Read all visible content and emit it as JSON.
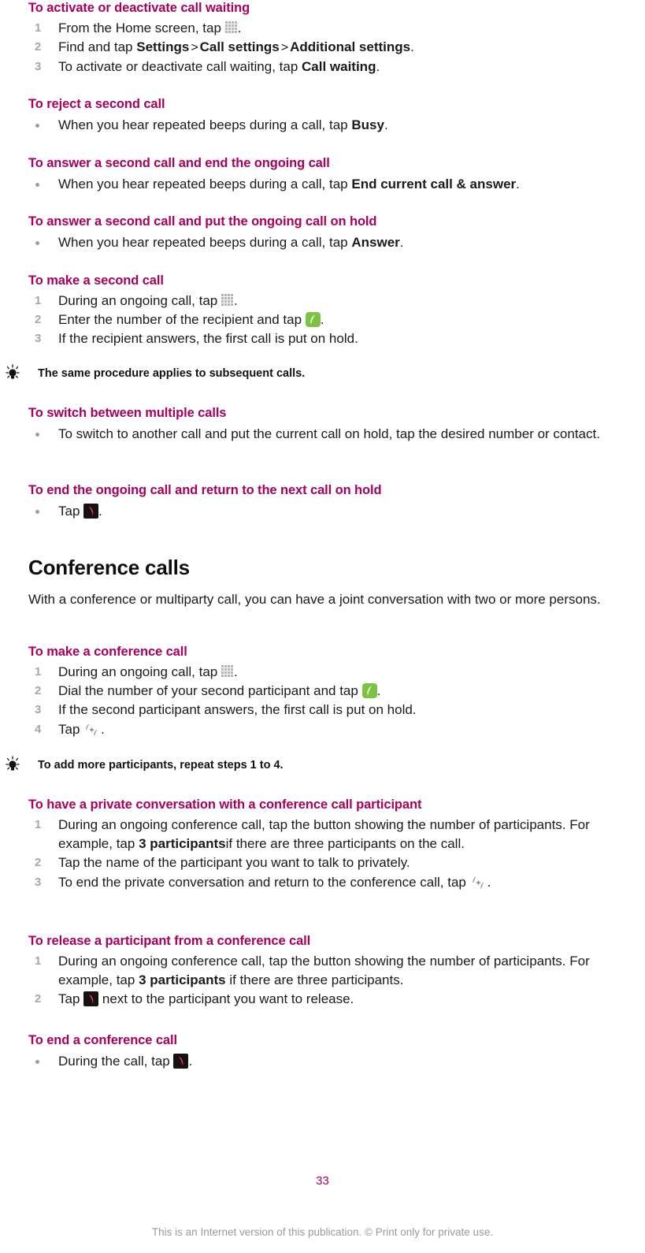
{
  "document": {
    "page_number": "33",
    "footer_note": "This is an Internet version of this publication. © Print only for private use.",
    "accent_color": "#a8005c",
    "body_color": "#1a1a1a",
    "number_color": "#a6a6a6",
    "call_icon_color": "#7dc242",
    "end_call_icon_color": "#17110f"
  },
  "sections": {
    "call_waiting": {
      "title": "To activate or deactivate call waiting",
      "steps": [
        {
          "num": "1",
          "pre": "From the Home screen, tap ",
          "icon": "app-drawer-grid-icon",
          "post": "."
        },
        {
          "num": "2",
          "pre": "Find and tap ",
          "b1": "Settings",
          "sep1": ">",
          "b2": "Call settings",
          "sep2": ">",
          "b3": "Additional settings",
          "post": "."
        },
        {
          "num": "3",
          "pre": "To activate or deactivate call waiting, tap ",
          "b1": "Call waiting",
          "post": "."
        }
      ]
    },
    "reject_second": {
      "title": "To reject a second call",
      "bullet_pre": "When you hear repeated beeps during a call, tap ",
      "bullet_bold": "Busy",
      "bullet_post": "."
    },
    "answer_end_ongoing": {
      "title": "To answer a second call and end the ongoing call",
      "bullet_pre": "When you hear repeated beeps during a call, tap ",
      "bullet_bold": "End current call & answer",
      "bullet_post": "."
    },
    "answer_hold_ongoing": {
      "title": "To answer a second call and put the ongoing call on hold",
      "bullet_pre": "When you hear repeated beeps during a call, tap ",
      "bullet_bold": "Answer",
      "bullet_post": "."
    },
    "make_second": {
      "title": "To make a second call",
      "steps": [
        {
          "num": "1",
          "pre": "During an ongoing call, tap ",
          "icon": "dialpad-grid-icon",
          "post": "."
        },
        {
          "num": "2",
          "pre": "Enter the number of the recipient and tap ",
          "icon": "green-call-icon",
          "post": "."
        },
        {
          "num": "3",
          "text": "If the recipient answers, the first call is put on hold."
        }
      ],
      "tip": "The same procedure applies to subsequent calls."
    },
    "switch_calls": {
      "title": "To switch between multiple calls",
      "bullet_text": "To switch to another call and put the current call on hold, tap the desired number or contact."
    },
    "end_return_hold": {
      "title": "To end the ongoing call and return to the next call on hold",
      "bullet_pre": "Tap ",
      "icon": "end-call-icon",
      "bullet_post": "."
    },
    "conference": {
      "heading": "Conference calls",
      "intro": "With a conference or multiparty call, you can have a joint conversation with two or more persons."
    },
    "make_conference": {
      "title": "To make a conference call",
      "steps": [
        {
          "num": "1",
          "pre": "During an ongoing call, tap ",
          "icon": "dialpad-grid-icon",
          "post": "."
        },
        {
          "num": "2",
          "pre": "Dial the number of your second participant and tap ",
          "icon": "green-call-icon",
          "post": "."
        },
        {
          "num": "3",
          "text": "If the second participant answers, the first call is put on hold."
        },
        {
          "num": "4",
          "pre": "Tap ",
          "icon": "merge-calls-icon",
          "post": "."
        }
      ],
      "tip": "To add more participants, repeat steps 1 to 4."
    },
    "private_conversation": {
      "title": "To have a private conversation with a conference call participant",
      "steps": [
        {
          "num": "1",
          "pre": "During an ongoing conference call, tap the button showing the number of participants. For example, tap ",
          "b1": "3 participants",
          "post": "if there are three participants on the call."
        },
        {
          "num": "2",
          "text": "Tap the name of the participant you want to talk to privately."
        },
        {
          "num": "3",
          "pre": "To end the private conversation and return to the conference call, tap ",
          "icon": "merge-calls-icon",
          "post": "."
        }
      ]
    },
    "release_participant": {
      "title": "To release a participant from a conference call",
      "steps": [
        {
          "num": "1",
          "pre": "During an ongoing conference call, tap the button showing the number of participants. For example, tap ",
          "b1": "3 participants",
          "post": " if there are three participants."
        },
        {
          "num": "2",
          "pre": "Tap ",
          "icon": "end-call-icon",
          "post": " next to the participant you want to release."
        }
      ]
    },
    "end_conference": {
      "title": "To end a conference call",
      "bullet_pre": "During the call, tap ",
      "icon": "end-call-icon",
      "bullet_post": "."
    }
  }
}
